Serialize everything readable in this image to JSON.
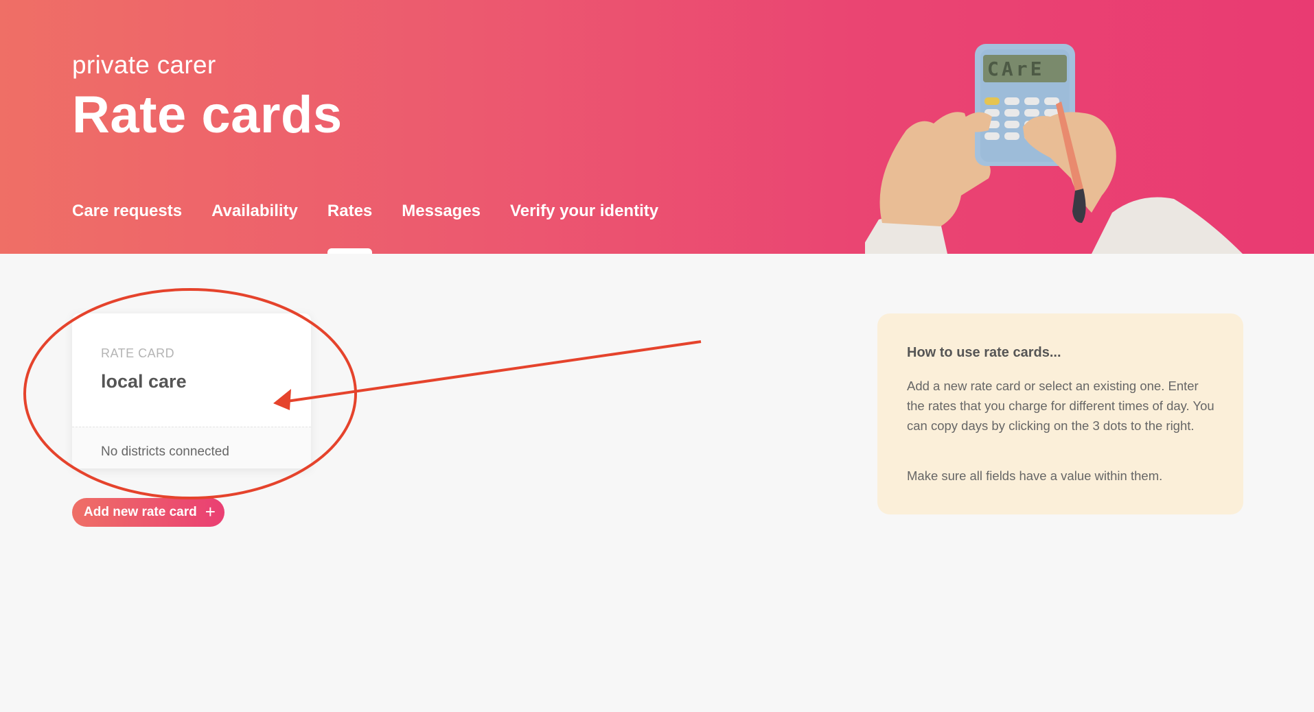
{
  "header": {
    "subtitle": "private carer",
    "title": "Rate cards",
    "illustration": {
      "calculator_display": "CArE",
      "icon": "hands-calculator-illustration"
    }
  },
  "nav": {
    "items": [
      {
        "label": "Care requests",
        "active": false
      },
      {
        "label": "Availability",
        "active": false
      },
      {
        "label": "Rates",
        "active": true
      },
      {
        "label": "Messages",
        "active": false
      },
      {
        "label": "Verify your identity",
        "active": false
      }
    ]
  },
  "rate_card": {
    "label": "RATE CARD",
    "name": "local care",
    "districts": "No districts connected"
  },
  "add_button": {
    "label": "Add new rate card",
    "icon": "+"
  },
  "help": {
    "title": "How to use rate cards...",
    "text": "Add a new rate card or select an existing one. Enter the rates that you charge for different times of day. You can copy days by clicking on the 3 dots to the right.",
    "text2": "Make sure all fields have a value within them."
  },
  "colors": {
    "header_start": "#ef6f66",
    "header_end": "#e93b72",
    "annotation": "#e5432c",
    "help_bg": "#fbefd9"
  }
}
